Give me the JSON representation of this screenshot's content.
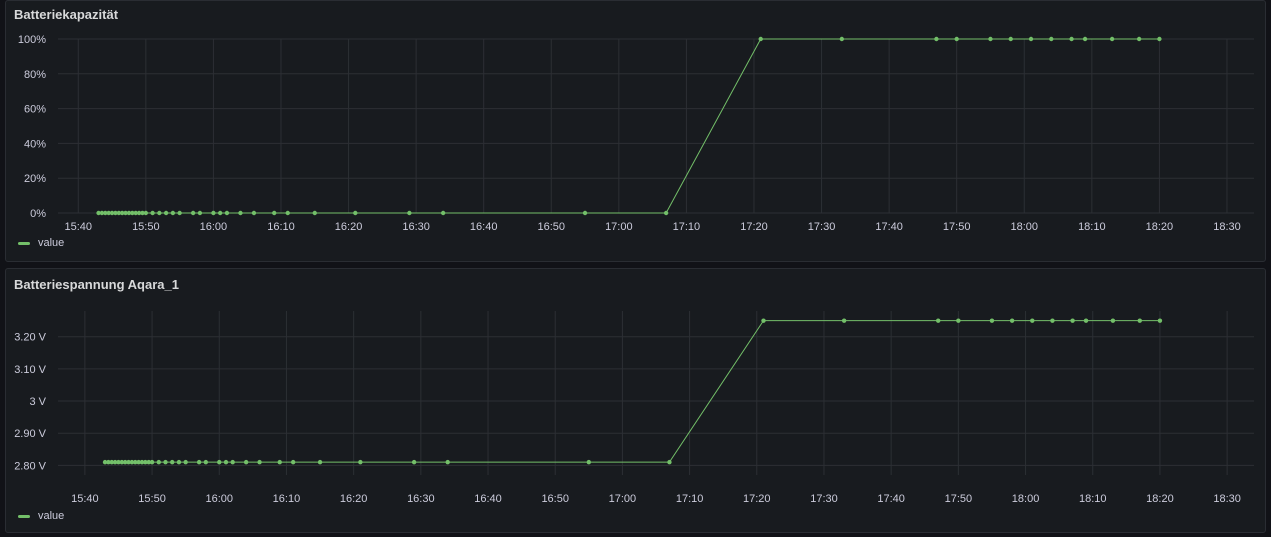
{
  "colors": {
    "series": "#73bf69",
    "grid": "#2c2f34",
    "axis_text": "#ccccdc"
  },
  "chart_data": [
    {
      "type": "line",
      "title": "Batteriekapazität",
      "x_ticks": [
        "15:40",
        "15:50",
        "16:00",
        "16:10",
        "16:20",
        "16:30",
        "16:40",
        "16:50",
        "17:00",
        "17:10",
        "17:20",
        "17:30",
        "17:40",
        "17:50",
        "18:00",
        "18:10",
        "18:20",
        "18:30"
      ],
      "x_range": [
        "15:37",
        "18:34"
      ],
      "y_ticks": [
        "0%",
        "20%",
        "40%",
        "60%",
        "80%",
        "100%"
      ],
      "y_tick_values": [
        0,
        20,
        40,
        60,
        80,
        100
      ],
      "ylim": [
        0,
        100
      ],
      "grid": true,
      "legend_position": "bottom-left",
      "series": [
        {
          "name": "value",
          "x": [
            "15:43",
            "15:43.5",
            "15:44",
            "15:44.5",
            "15:45",
            "15:45.5",
            "15:46",
            "15:46.5",
            "15:47",
            "15:47.5",
            "15:48",
            "15:48.5",
            "15:49",
            "15:49.5",
            "15:50",
            "15:51",
            "15:52",
            "15:53",
            "15:54",
            "15:55",
            "15:57",
            "15:58",
            "16:00",
            "16:01",
            "16:02",
            "16:04",
            "16:06",
            "16:09",
            "16:11",
            "16:15",
            "16:21",
            "16:29",
            "16:34",
            "16:55",
            "17:07",
            "17:21",
            "17:33",
            "17:47",
            "17:50",
            "17:55",
            "17:58",
            "18:01",
            "18:04",
            "18:07",
            "18:09",
            "18:13",
            "18:17",
            "18:20"
          ],
          "values": [
            0,
            0,
            0,
            0,
            0,
            0,
            0,
            0,
            0,
            0,
            0,
            0,
            0,
            0,
            0,
            0,
            0,
            0,
            0,
            0,
            0,
            0,
            0,
            0,
            0,
            0,
            0,
            0,
            0,
            0,
            0,
            0,
            0,
            0,
            0,
            100,
            100,
            100,
            100,
            100,
            100,
            100,
            100,
            100,
            100,
            100,
            100,
            100
          ]
        }
      ]
    },
    {
      "type": "line",
      "title": "Batteriespannung Aqara_1",
      "x_ticks": [
        "15:40",
        "15:50",
        "16:00",
        "16:10",
        "16:20",
        "16:30",
        "16:40",
        "16:50",
        "17:00",
        "17:10",
        "17:20",
        "17:30",
        "17:40",
        "17:50",
        "18:00",
        "18:10",
        "18:20",
        "18:30"
      ],
      "x_range": [
        "15:36",
        "18:34"
      ],
      "y_ticks": [
        "2.80 V",
        "2.90 V",
        "3 V",
        "3.10 V",
        "3.20 V"
      ],
      "y_tick_values": [
        2.8,
        2.9,
        3.0,
        3.1,
        3.2
      ],
      "ylim": [
        2.77,
        3.28
      ],
      "grid": true,
      "legend_position": "bottom-left",
      "series": [
        {
          "name": "value",
          "x": [
            "15:43",
            "15:43.5",
            "15:44",
            "15:44.5",
            "15:45",
            "15:45.5",
            "15:46",
            "15:46.5",
            "15:47",
            "15:47.5",
            "15:48",
            "15:48.5",
            "15:49",
            "15:49.5",
            "15:50",
            "15:51",
            "15:52",
            "15:53",
            "15:54",
            "15:55",
            "15:57",
            "15:58",
            "16:00",
            "16:01",
            "16:02",
            "16:04",
            "16:06",
            "16:09",
            "16:11",
            "16:15",
            "16:21",
            "16:29",
            "16:34",
            "16:55",
            "17:07",
            "17:21",
            "17:33",
            "17:47",
            "17:50",
            "17:55",
            "17:58",
            "18:01",
            "18:04",
            "18:07",
            "18:09",
            "18:13",
            "18:17",
            "18:20"
          ],
          "values": [
            2.81,
            2.81,
            2.81,
            2.81,
            2.81,
            2.81,
            2.81,
            2.81,
            2.81,
            2.81,
            2.81,
            2.81,
            2.81,
            2.81,
            2.81,
            2.81,
            2.81,
            2.81,
            2.81,
            2.81,
            2.81,
            2.81,
            2.81,
            2.81,
            2.81,
            2.81,
            2.81,
            2.81,
            2.81,
            2.81,
            2.81,
            2.81,
            2.81,
            2.81,
            2.81,
            3.25,
            3.25,
            3.25,
            3.25,
            3.25,
            3.25,
            3.25,
            3.25,
            3.25,
            3.25,
            3.25,
            3.25,
            3.25
          ]
        }
      ]
    }
  ]
}
